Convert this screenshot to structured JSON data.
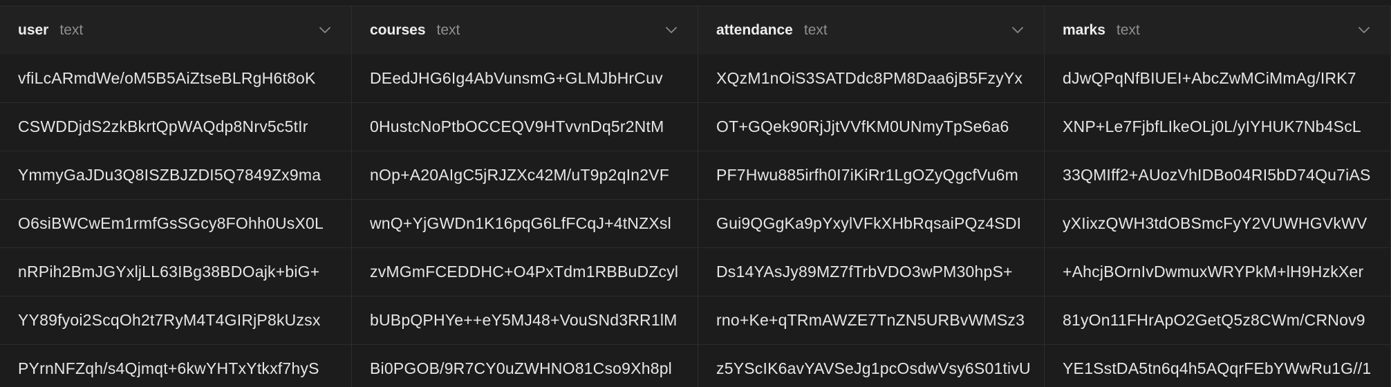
{
  "columns": [
    {
      "name": "user",
      "type": "text"
    },
    {
      "name": "courses",
      "type": "text"
    },
    {
      "name": "attendance",
      "type": "text"
    },
    {
      "name": "marks",
      "type": "text"
    }
  ],
  "rows": [
    [
      "vfiLcARmdWe/oM5B5AiZtseBLRgH6t8oK",
      "DEedJHG6Ig4AbVunsmG+GLMJbHrCuv",
      "XQzM1nOiS3SATDdc8PM8Daa6jB5FzyYx",
      "dJwQPqNfBIUEI+AbcZwMCiMmAg/IRK7"
    ],
    [
      "CSWDDjdS2zkBkrtQpWAQdp8Nrv5c5tIr",
      "0HustcNoPtbOCCEQV9HTvvnDq5r2NtM",
      "OT+GQek90RjJjtVVfKM0UNmyTpSe6a6",
      "XNP+Le7FjbfLIkeOLj0L/yIYHUK7Nb4ScL"
    ],
    [
      "YmmyGaJDu3Q8ISZBJZDI5Q7849Zx9ma",
      "nOp+A20AIgC5jRJZXc42M/uT9p2qIn2VF",
      "PF7Hwu885irfh0I7iKiRr1LgOZyQgcfVu6m",
      "33QMIff2+AUozVhIDBo04RI5bD74Qu7iAS"
    ],
    [
      "O6siBWCwEm1rmfGsSGcy8FOhh0UsX0L",
      "wnQ+YjGWDn1K16pqG6LfFCqJ+4tNZXsl",
      "Gui9QGgKa9pYxylVFkXHbRqsaiPQz4SDI",
      "yXIixzQWH3tdOBSmcFyY2VUWHGVkWV"
    ],
    [
      "nRPih2BmJGYxljLL63IBg38BDOajk+biG+",
      "zvMGmFCEDDHC+O4PxTdm1RBBuDZcyl",
      "Ds14YAsJy89MZ7fTrbVDO3wPM30hpS+",
      "+AhcjBOrnIvDwmuxWRYPkM+lH9HzkXer"
    ],
    [
      "YY89fyoi2ScqOh2t7RyM4T4GIRjP8kUzsx",
      "bUBpQPHYe++eY5MJ48+VouSNd3RR1lM",
      "rno+Ke+qTRmAWZE7TnZN5URBvWMSz3",
      "81yOn11FHrApO2GetQ5z8CWm/CRNov9"
    ],
    [
      "PYrnNFZqh/s4Qjmqt+6kwYHTxYtkxf7hyS",
      "Bi0PGOB/9R7CY0uZWHNO81Cso9Xh8pl",
      "z5YScIK6avYAVSeJg1pcOsdwVsy6S01tivU",
      "YE1SstDA5tn6q4h5AQqrFEbYWwRu1G//1"
    ]
  ]
}
